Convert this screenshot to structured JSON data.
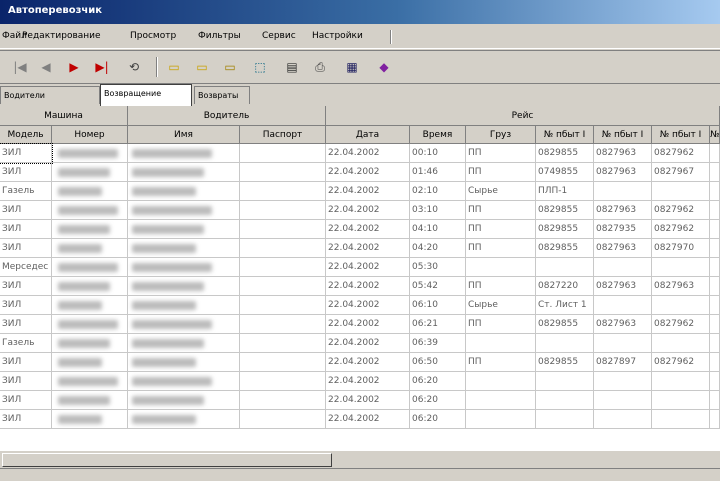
{
  "window": {
    "title": "Автоперевозчик"
  },
  "menu": {
    "items": [
      {
        "label": "Файл"
      },
      {
        "label": "Редактирование"
      },
      {
        "label": "Просмотр"
      },
      {
        "label": "Фильтры"
      },
      {
        "label": "Сервис"
      },
      {
        "label": "Настройки"
      }
    ]
  },
  "toolbar": {
    "buttons": [
      {
        "icon": "first-record-icon",
        "glyph": "|◀"
      },
      {
        "icon": "prev-record-icon",
        "glyph": "◀"
      },
      {
        "icon": "next-record-icon",
        "glyph": "▶"
      },
      {
        "icon": "last-record-icon",
        "glyph": "▶|"
      },
      {
        "icon": "refresh-icon",
        "glyph": "⟲"
      },
      {
        "icon": "open-folder-icon",
        "glyph": "▭"
      },
      {
        "icon": "folder-edit-icon",
        "glyph": "▭"
      },
      {
        "icon": "folder-delete-icon",
        "glyph": "▭"
      },
      {
        "icon": "network-icon",
        "glyph": "⬚"
      },
      {
        "icon": "document-icon",
        "glyph": "▤"
      },
      {
        "icon": "print-icon",
        "glyph": "⎙"
      },
      {
        "icon": "calculator-icon",
        "glyph": "▦"
      },
      {
        "icon": "settings-icon",
        "glyph": "◆"
      }
    ]
  },
  "tabs": [
    {
      "label": "Водители"
    },
    {
      "label": "Возвращение"
    },
    {
      "label": "Возвраты"
    }
  ],
  "grid": {
    "groups": [
      "Машина",
      "Водитель",
      "Рейс"
    ],
    "columns": [
      "Модель",
      "Номер",
      "Имя",
      "Паспорт",
      "Дата",
      "Время",
      "Груз",
      "№ пбыт I",
      "№ пбыт I",
      "№ пбыт I",
      "№"
    ],
    "rows": [
      {
        "model": "ЗИЛ",
        "date": "22.04.2002",
        "time": "00:10",
        "cargo": "ПП",
        "n1": "0829855",
        "n2": "0827963",
        "n3": "0827962"
      },
      {
        "model": "ЗИЛ",
        "date": "22.04.2002",
        "time": "01:46",
        "cargo": "ПП",
        "n1": "0749855",
        "n2": "0827963",
        "n3": "0827967"
      },
      {
        "model": "Газель",
        "date": "22.04.2002",
        "time": "02:10",
        "cargo": "Сырье",
        "n1": "ПЛП-1",
        "n2": "",
        "n3": ""
      },
      {
        "model": "ЗИЛ",
        "date": "22.04.2002",
        "time": "03:10",
        "cargo": "ПП",
        "n1": "0829855",
        "n2": "0827963",
        "n3": "0827962"
      },
      {
        "model": "ЗИЛ",
        "date": "22.04.2002",
        "time": "04:10",
        "cargo": "ПП",
        "n1": "0829855",
        "n2": "0827935",
        "n3": "0827962"
      },
      {
        "model": "ЗИЛ",
        "date": "22.04.2002",
        "time": "04:20",
        "cargo": "ПП",
        "n1": "0829855",
        "n2": "0827963",
        "n3": "0827970"
      },
      {
        "model": "Мерседес",
        "date": "22.04.2002",
        "time": "05:30",
        "cargo": "",
        "n1": "",
        "n2": "",
        "n3": ""
      },
      {
        "model": "ЗИЛ",
        "date": "22.04.2002",
        "time": "05:42",
        "cargo": "ПП",
        "n1": "0827220",
        "n2": "0827963",
        "n3": "0827963"
      },
      {
        "model": "ЗИЛ",
        "date": "22.04.2002",
        "time": "06:10",
        "cargo": "Сырье",
        "n1": "Ст. Лист 1",
        "n2": "",
        "n3": ""
      },
      {
        "model": "ЗИЛ",
        "date": "22.04.2002",
        "time": "06:21",
        "cargo": "ПП",
        "n1": "0829855",
        "n2": "0827963",
        "n3": "0827962"
      },
      {
        "model": "Газель",
        "date": "22.04.2002",
        "time": "06:39",
        "cargo": "",
        "n1": "",
        "n2": "",
        "n3": ""
      },
      {
        "model": "ЗИЛ",
        "date": "22.04.2002",
        "time": "06:50",
        "cargo": "ПП",
        "n1": "0829855",
        "n2": "0827897",
        "n3": "0827962"
      },
      {
        "model": "ЗИЛ",
        "date": "22.04.2002",
        "time": "06:20",
        "cargo": "",
        "n1": "",
        "n2": "",
        "n3": ""
      },
      {
        "model": "ЗИЛ",
        "date": "22.04.2002",
        "time": "06:20",
        "cargo": "",
        "n1": "",
        "n2": "",
        "n3": ""
      },
      {
        "model": "ЗИЛ",
        "date": "22.04.2002",
        "time": "06:20",
        "cargo": "",
        "n1": "",
        "n2": "",
        "n3": ""
      }
    ]
  }
}
